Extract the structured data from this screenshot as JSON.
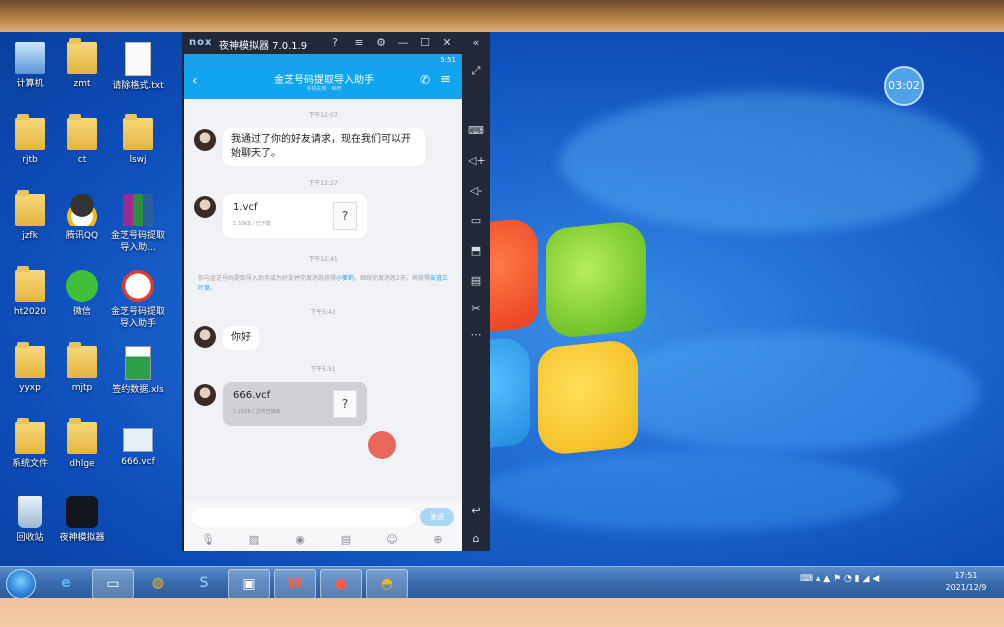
{
  "desktop": {
    "icons": [
      {
        "label": "计算机",
        "icon": "computer-icon"
      },
      {
        "label": "zmt",
        "icon": "folder-icon"
      },
      {
        "label": "请除格式.txt",
        "icon": "text-file-icon"
      },
      {
        "label": "rjtb",
        "icon": "folder-icon"
      },
      {
        "label": "ct",
        "icon": "folder-icon"
      },
      {
        "label": "lswj",
        "icon": "folder-icon"
      },
      {
        "label": "jzfk",
        "icon": "folder-icon"
      },
      {
        "label": "腾讯QQ",
        "icon": "qq-icon"
      },
      {
        "label": "金芝号码提取导入助...",
        "icon": "archive-icon"
      },
      {
        "label": "ht2020",
        "icon": "folder-icon"
      },
      {
        "label": "微信",
        "icon": "wechat-icon"
      },
      {
        "label": "金芝号码提取导入助手",
        "icon": "app-icon"
      },
      {
        "label": "yyxp",
        "icon": "folder-icon"
      },
      {
        "label": "mjtp",
        "icon": "folder-icon"
      },
      {
        "label": "签约数据.xls",
        "icon": "excel-icon"
      },
      {
        "label": "系统文件",
        "icon": "folder-icon"
      },
      {
        "label": "dhlge",
        "icon": "folder-icon"
      },
      {
        "label": "666.vcf",
        "icon": "vcf-icon"
      },
      {
        "label": "回收站",
        "icon": "recycle-bin-icon"
      },
      {
        "label": "夜神模拟器",
        "icon": "nox-icon"
      }
    ],
    "timer": "03:02"
  },
  "emulator": {
    "logo": "nox",
    "title": "夜神模拟器 7.0.1.9",
    "status_time": "5:51",
    "chat": {
      "name": "金芝号码提取导入助手",
      "subtitle": "手机在线 - WiFi"
    },
    "messages": {
      "t1": "下午12:07",
      "m1": "我通过了你的好友请求，现在我们可以开始聊天了。",
      "t2": "下午12:27",
      "f1_name": "1.vcf",
      "f1_meta": "1.33KB / 已下载",
      "t3": "下午12:41",
      "system_a": "你与金芝号码提取导入助手成为好友并完发消息获得",
      "system_b": "小萝莉",
      "system_c": "，继续完发消息2天，将获得",
      "system_d": "友谊三叶草",
      "system_e": "。",
      "t4": "下午5:42",
      "m2": "你好",
      "t5": "下午5:51",
      "f2_name": "666.vcf",
      "f2_meta": "1.21KB / 文件已接收",
      "file_icon_text": "?"
    },
    "send_label": "发送"
  },
  "taskbar": {
    "clock_time": "17:51",
    "clock_date": "2021/12/9"
  },
  "colors": {
    "accent": "#12a5ef",
    "desktop_blue": "#1f6ad3",
    "cursor_red": "#e8584d"
  }
}
